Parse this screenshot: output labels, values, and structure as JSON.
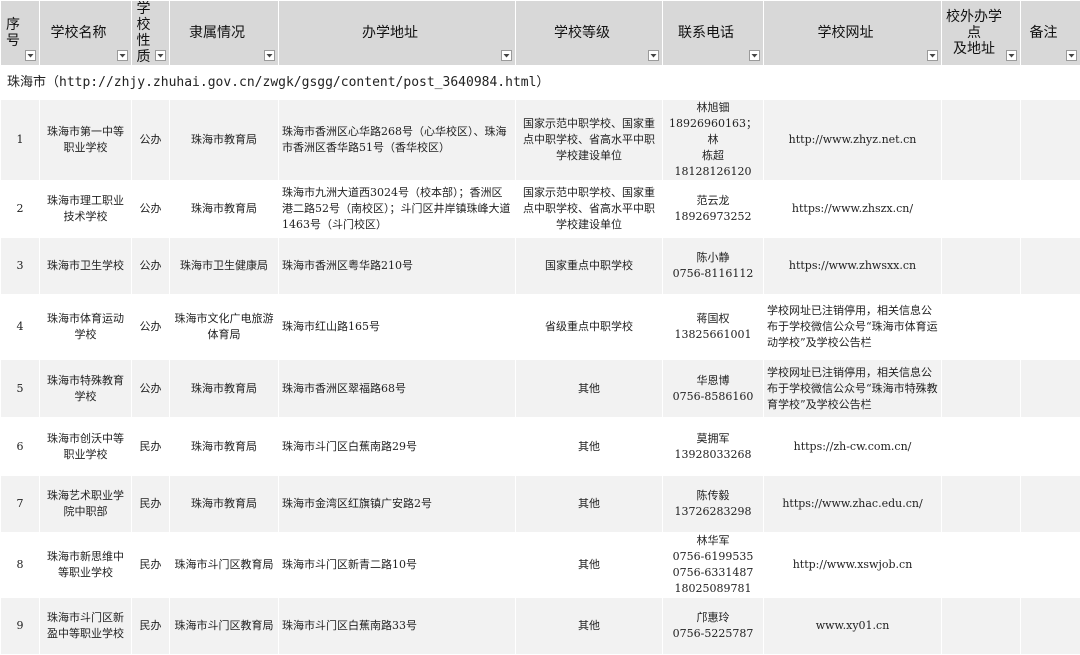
{
  "headers": [
    {
      "lines": [
        "序号"
      ],
      "align": "left"
    },
    {
      "lines": [
        "学校名称"
      ],
      "align": "center"
    },
    {
      "lines": [
        "学校",
        "性质"
      ],
      "align": "center"
    },
    {
      "lines": [
        "隶属情况"
      ],
      "align": "center"
    },
    {
      "lines": [
        "办学地址"
      ],
      "align": "center"
    },
    {
      "lines": [
        "学校等级"
      ],
      "align": "center"
    },
    {
      "lines": [
        "联系电话"
      ],
      "align": "center"
    },
    {
      "lines": [
        "学校网址"
      ],
      "align": "center"
    },
    {
      "lines": [
        "校外办学点",
        "及地址"
      ],
      "align": "center"
    },
    {
      "lines": [
        "备注"
      ],
      "align": "center"
    }
  ],
  "section": {
    "label": "珠海市（http://zhjy.zhuhai.gov.cn/zwgk/gsgg/content/post_3640984.html）"
  },
  "rows": [
    {
      "no": "1",
      "name": "珠海市第一中等职业学校",
      "nature": "公办",
      "affiliation": "珠海市教育局",
      "address": "珠海市香洲区心华路268号（心华校区）、珠海市香洲区香华路51号（香华校区）",
      "level": "国家示范中职学校、国家重点中职学校、省高水平中职学校建设单位",
      "phone": [
        "林旭钿",
        "18926960163；林",
        "栋超18128126120"
      ],
      "website": "http://www.zhyz.net.cn",
      "offsite": "",
      "remark": ""
    },
    {
      "no": "2",
      "name": "珠海市理工职业技术学校",
      "nature": "公办",
      "affiliation": "珠海市教育局",
      "address": "珠海市九洲大道西3024号（校本部）；香洲区港二路52号（南校区）；斗门区井岸镇珠峰大道1463号（斗门校区）",
      "level": "国家示范中职学校、国家重点中职学校、省高水平中职学校建设单位",
      "phone": [
        "范云龙",
        "18926973252"
      ],
      "website": "https://www.zhszx.cn/",
      "offsite": "",
      "remark": ""
    },
    {
      "no": "3",
      "name": "珠海市卫生学校",
      "nature": "公办",
      "affiliation": "珠海市卫生健康局",
      "address": "珠海市香洲区粤华路210号",
      "level": "国家重点中职学校",
      "phone": [
        "陈小静",
        "0756-8116112"
      ],
      "website": "https://www.zhwsxx.cn",
      "offsite": "",
      "remark": ""
    },
    {
      "no": "4",
      "name": "珠海市体育运动学校",
      "nature": "公办",
      "affiliation": "珠海市文化广电旅游体育局",
      "address": "珠海市红山路165号",
      "level": "省级重点中职学校",
      "phone": [
        "蒋国权",
        "13825661001"
      ],
      "website": "学校网址已注销停用，相关信息公布于学校微信公众号“珠海市体育运动学校”及学校公告栏",
      "offsite": "",
      "remark": ""
    },
    {
      "no": "5",
      "name": "珠海市特殊教育学校",
      "nature": "公办",
      "affiliation": "珠海市教育局",
      "address": "珠海市香洲区翠福路68号",
      "level": "其他",
      "phone": [
        "华恩博",
        "0756-8586160"
      ],
      "website": "学校网址已注销停用，相关信息公布于学校微信公众号“珠海市特殊教育学校”及学校公告栏",
      "offsite": "",
      "remark": ""
    },
    {
      "no": "6",
      "name": "珠海市创沃中等职业学校",
      "nature": "民办",
      "affiliation": "珠海市教育局",
      "address": "珠海市斗门区白蕉南路29号",
      "level": "其他",
      "phone": [
        "莫拥军",
        "13928033268"
      ],
      "website": "https://zh-cw.com.cn/",
      "offsite": "",
      "remark": ""
    },
    {
      "no": "7",
      "name": "珠海艺术职业学院中职部",
      "nature": "民办",
      "affiliation": "珠海市教育局",
      "address": "珠海市金湾区红旗镇广安路2号",
      "level": "其他",
      "phone": [
        "陈传毅",
        "13726283298"
      ],
      "website": "https://www.zhac.edu.cn/",
      "offsite": "",
      "remark": ""
    },
    {
      "no": "8",
      "name": "珠海市新思维中等职业学校",
      "nature": "民办",
      "affiliation": "珠海市斗门区教育局",
      "address": "珠海市斗门区新青二路10号",
      "level": "其他",
      "phone": [
        "林华军",
        "0756-6199535",
        "0756-6331487",
        "18025089781"
      ],
      "website": "http://www.xswjob.cn",
      "offsite": "",
      "remark": ""
    },
    {
      "no": "9",
      "name": "珠海市斗门区新盈中等职业学校",
      "nature": "民办",
      "affiliation": "珠海市斗门区教育局",
      "address": "珠海市斗门区白蕉南路33号",
      "level": "其他",
      "phone": [
        "邝惠玲",
        "0756-5225787"
      ],
      "website": "www.xy01.cn",
      "offsite": "",
      "remark": ""
    }
  ],
  "colors": {
    "header_bg": "#d8d8d8",
    "row_bg": "#f2f2f2",
    "alt_row_bg": "#ffffff"
  }
}
